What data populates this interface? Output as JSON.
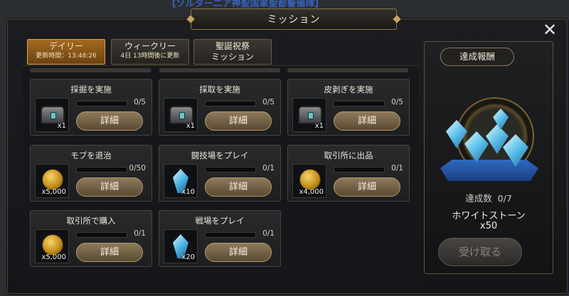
{
  "background_banner": "【ソルターニア神聖国軍聖都警備隊】",
  "window": {
    "title": "ミッション"
  },
  "tabs": [
    {
      "label": "デイリー",
      "sub": "更新時間：13:48:26",
      "active": true
    },
    {
      "label": "ウィークリー",
      "sub": "4日 13時間後に更新",
      "active": false
    },
    {
      "label": "聖誕祝祭",
      "sub": "ミッション",
      "active": false
    }
  ],
  "missions": [
    {
      "title": "採掘を実施",
      "reward_icon": "chest-icon",
      "reward_qty": "x1",
      "progress": "0/5",
      "detail_label": "詳細"
    },
    {
      "title": "採取を実施",
      "reward_icon": "chest-icon",
      "reward_qty": "x1",
      "progress": "0/5",
      "detail_label": "詳細"
    },
    {
      "title": "皮剥ぎを実施",
      "reward_icon": "chest-icon",
      "reward_qty": "x1",
      "progress": "0/5",
      "detail_label": "詳細"
    },
    {
      "title": "モブを退治",
      "reward_icon": "gold-coin-icon",
      "reward_qty": "x5,000",
      "progress": "0/50",
      "detail_label": "詳細"
    },
    {
      "title": "闘技場をプレイ",
      "reward_icon": "crystal-icon",
      "reward_qty": "x10",
      "progress": "0/1",
      "detail_label": "詳細"
    },
    {
      "title": "取引所に出品",
      "reward_icon": "gold-coin-icon",
      "reward_qty": "x4,000",
      "progress": "0/1",
      "detail_label": "詳細"
    },
    {
      "title": "取引所で購入",
      "reward_icon": "gold-coin-icon",
      "reward_qty": "x5,000",
      "progress": "0/1",
      "detail_label": "詳細"
    },
    {
      "title": "戦場をプレイ",
      "reward_icon": "crystal-icon",
      "reward_qty": "x20",
      "progress": "0/1",
      "detail_label": "詳細"
    }
  ],
  "reward": {
    "heading": "達成報酬",
    "count_label": "達成数",
    "count": "0/7",
    "item_name": "ホワイトストーン",
    "item_qty": "x50",
    "claim_label": "受け取る",
    "icon": "white-stone-crystals-icon"
  },
  "colors": {
    "active_tab": "#a36a1e",
    "detail_button": "#8d7a5c",
    "ribbon": "#2f6ac0",
    "frame_gold": "#8a7448"
  }
}
